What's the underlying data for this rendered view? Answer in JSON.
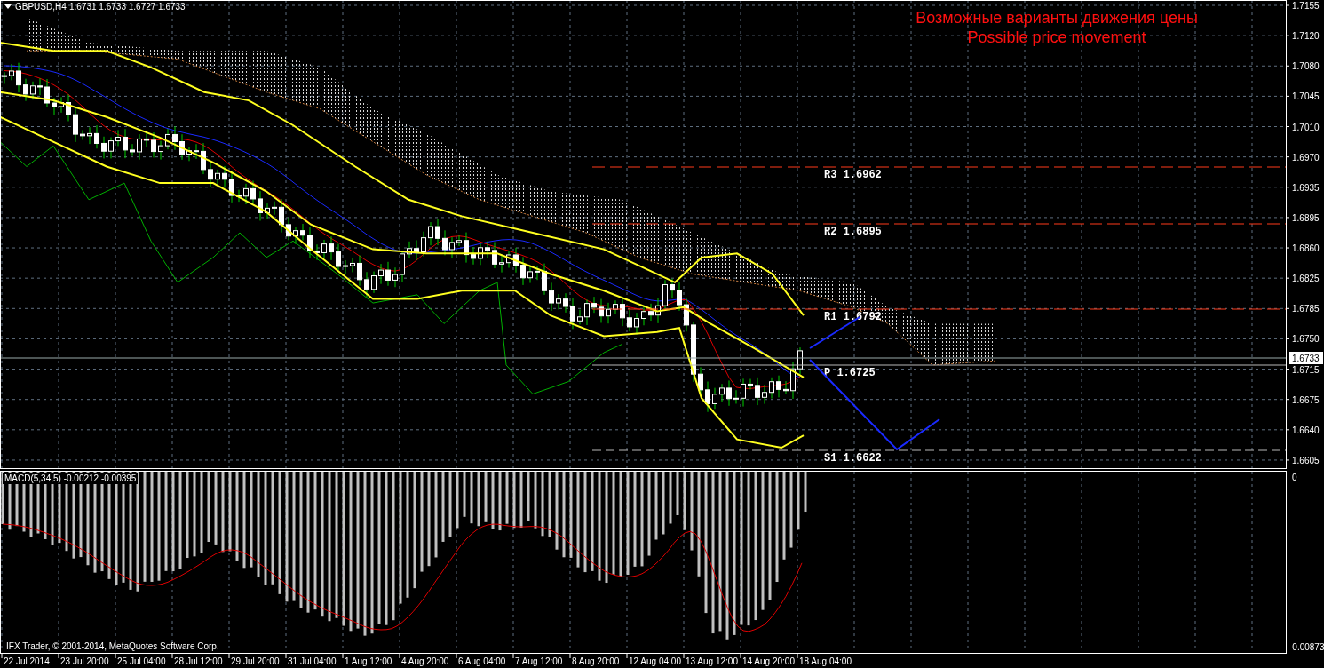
{
  "chart": {
    "symbol": "GBPUSD,H4",
    "quotes": "1.6731 1.6733 1.6727 1.6733",
    "title_lines": [
      "Возможные варианты движения цены",
      "Possible price movement"
    ],
    "price_axis": [
      "1.7155",
      "1.7120",
      "1.7080",
      "1.7045",
      "1.7010",
      "1.6970",
      "1.6935",
      "1.6895",
      "1.6860",
      "1.6825",
      "1.6785",
      "1.6750",
      "1.6715",
      "1.6675",
      "1.6640",
      "1.6605"
    ],
    "current_price": "1.6733",
    "pivots": [
      {
        "kind": "resistance",
        "label": "R3 1.6962"
      },
      {
        "kind": "resistance",
        "label": "R2 1.6895"
      },
      {
        "kind": "resistance",
        "label": "R1 1.6792"
      },
      {
        "kind": "pivot",
        "label": "P 1.6725"
      },
      {
        "kind": "support",
        "label": "S1 1.6622"
      }
    ],
    "indicator": "MACD(5,34,5) -0.00212 -0.00395",
    "indicator_axis": [
      "0",
      "-0.00873"
    ],
    "time_axis": [
      "22 Jul 2014",
      "23 Jul 20:00",
      "25 Jul 04:00",
      "28 Jul 12:00",
      "29 Jul 20:00",
      "31 Jul 04:00",
      "1 Aug 12:00",
      "4 Aug 20:00",
      "6 Aug 04:00",
      "7 Aug 12:00",
      "8 Aug 20:00",
      "12 Aug 04:00",
      "13 Aug 12:00",
      "14 Aug 20:00",
      "18 Aug 04:00"
    ],
    "copyright": "IFX Trader, © 2001-2014, MetaQuotes Software Corp."
  }
}
